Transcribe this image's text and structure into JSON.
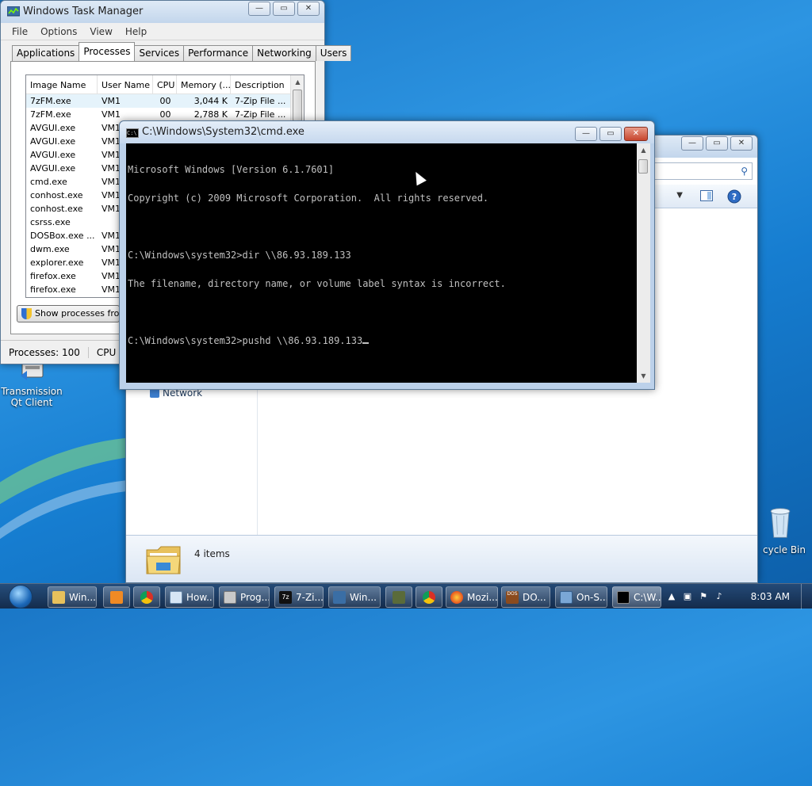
{
  "taskmgr": {
    "title": "Windows Task Manager",
    "menu": [
      "File",
      "Options",
      "View",
      "Help"
    ],
    "tabs": [
      "Applications",
      "Processes",
      "Services",
      "Performance",
      "Networking",
      "Users"
    ],
    "columns": [
      "Image Name",
      "User Name",
      "CPU",
      "Memory (...",
      "Description"
    ],
    "rows": [
      [
        "7zFM.exe",
        "VM1",
        "00",
        "3,044 K",
        "7-Zip File ..."
      ],
      [
        "7zFM.exe",
        "VM1",
        "00",
        "2,788 K",
        "7-Zip File ..."
      ],
      [
        "AVGUI.exe",
        "VM1",
        "",
        "",
        ""
      ],
      [
        "AVGUI.exe",
        "VM1",
        "",
        "",
        ""
      ],
      [
        "AVGUI.exe",
        "VM1",
        "",
        "",
        ""
      ],
      [
        "AVGUI.exe",
        "VM1",
        "",
        "",
        ""
      ],
      [
        "cmd.exe",
        "VM1",
        "",
        "",
        ""
      ],
      [
        "conhost.exe",
        "VM1",
        "",
        "",
        ""
      ],
      [
        "conhost.exe",
        "VM1",
        "",
        "",
        ""
      ],
      [
        "csrss.exe",
        "",
        "",
        "",
        ""
      ],
      [
        "DOSBox.exe ...",
        "VM1",
        "",
        "",
        ""
      ],
      [
        "dwm.exe",
        "VM1",
        "",
        "",
        ""
      ],
      [
        "explorer.exe",
        "VM1",
        "",
        "",
        ""
      ],
      [
        "firefox.exe",
        "VM1",
        "",
        "",
        ""
      ],
      [
        "firefox.exe",
        "VM1",
        "",
        "",
        ""
      ]
    ],
    "show_processes": "Show processes fro",
    "status_processes": "Processes: 100",
    "status_cpu": "CPU U"
  },
  "cmd": {
    "title": "C:\\Windows\\System32\\cmd.exe",
    "lines": [
      "Microsoft Windows [Version 6.1.7601]",
      "Copyright (c) 2009 Microsoft Corporation.  All rights reserved.",
      "",
      "C:\\Windows\\system32>dir \\\\86.93.189.133",
      "The filename, directory name, or volume label syntax is incorrect.",
      "",
      "C:\\Windows\\system32>pushd \\\\86.93.189.133"
    ]
  },
  "explorer": {
    "nav_item": "Network",
    "items_count": "4 items"
  },
  "desktop": {
    "transmission_label": "Transmission Qt Client",
    "recycle_label": "cycle Bin"
  },
  "taskbar": {
    "buttons": [
      "Win...",
      "How...",
      "Prog...",
      "7-Zi...",
      "Win...",
      "Mozi...",
      "DO...",
      "On-S...",
      "C:\\W..."
    ],
    "clock": "8:03 AM"
  },
  "colors": {
    "console_bg": "#000000",
    "console_fg": "#c0c0c0",
    "close_button": "#c7452e",
    "desktop_blue": "#1a77c7"
  }
}
